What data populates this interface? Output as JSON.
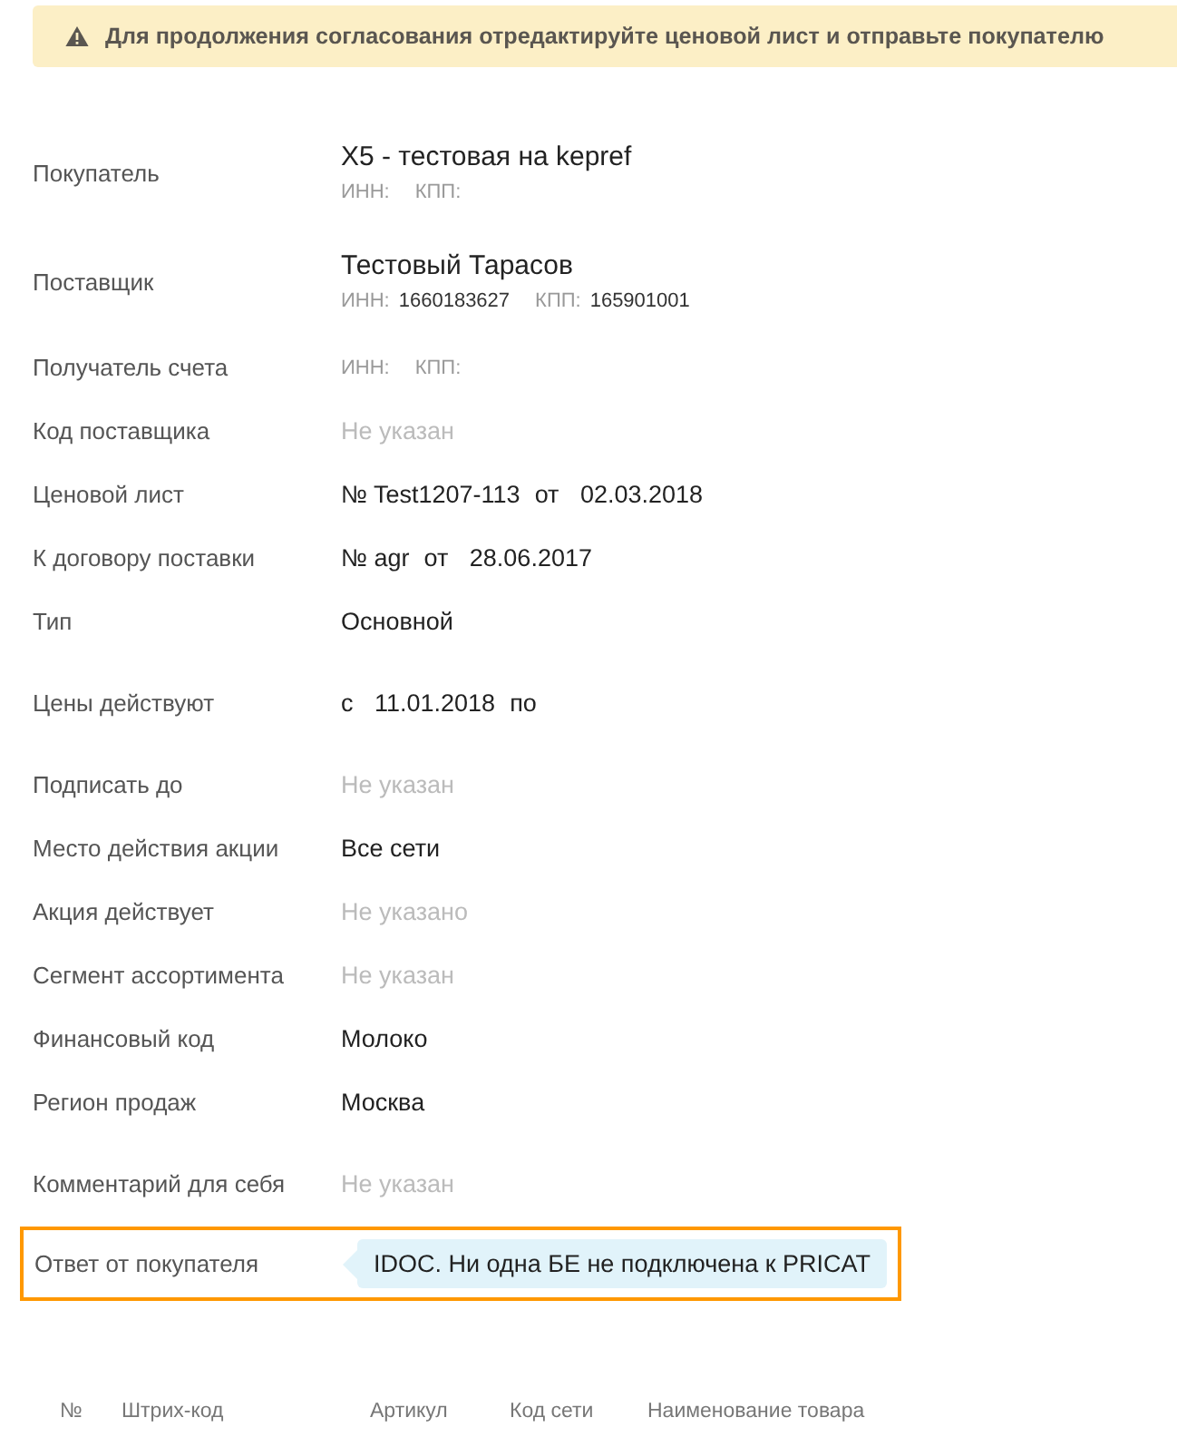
{
  "alert": {
    "text": "Для продолжения согласования отредактируйте ценовой лист и отправьте покупателю"
  },
  "field_groups": [
    [
      {
        "kind": "party",
        "label": "Покупатель",
        "name": "X5 - тестовая на kepref",
        "inn_label": "ИНН:",
        "kpp_label": "КПП:"
      },
      {
        "kind": "party",
        "label": "Поставщик",
        "name": "Тестовый Тарасов",
        "inn_label": "ИНН:",
        "inn": "1660183627",
        "kpp_label": "КПП:",
        "kpp": "165901001"
      },
      {
        "kind": "requisites",
        "label": "Получатель счета",
        "inn_label": "ИНН:",
        "kpp_label": "КПП:"
      },
      {
        "kind": "empty",
        "label": "Код поставщика",
        "value": "Не указан"
      },
      {
        "kind": "document",
        "label": "Ценовой лист",
        "number": "№ Test1207-113",
        "from": "от",
        "date": "02.03.2018"
      },
      {
        "kind": "document",
        "label": "К договору поставки",
        "number": "№ agr",
        "from": "от",
        "date": "28.06.2017"
      },
      {
        "kind": "text",
        "label": "Тип",
        "value": "Основной"
      }
    ],
    [
      {
        "kind": "period",
        "label": "Цены действуют",
        "from": "с",
        "date": "11.01.2018",
        "to": "по"
      }
    ],
    [
      {
        "kind": "empty",
        "label": "Подписать до",
        "value": "Не указан"
      },
      {
        "kind": "text",
        "label": "Место действия акции",
        "value": "Все сети"
      },
      {
        "kind": "empty",
        "label": "Акция действует",
        "value": "Не указано"
      },
      {
        "kind": "empty",
        "label": "Сегмент ассортимента",
        "value": "Не указан"
      },
      {
        "kind": "text",
        "label": "Финансовый код",
        "value": "Молоко"
      },
      {
        "kind": "text",
        "label": "Регион продаж",
        "value": "Москва"
      }
    ],
    [
      {
        "kind": "empty",
        "label": "Комментарий для себя",
        "value": "Не указан"
      }
    ]
  ],
  "buyer_reply": {
    "label": "Ответ от покупателя",
    "text": "IDOC. Ни одна БЕ не подключена к PRICAT",
    "highlighted": true
  },
  "table": {
    "columns": [
      "№",
      "Штрих-код",
      "Артикул",
      "Код сети",
      "Наименование товара"
    ]
  }
}
